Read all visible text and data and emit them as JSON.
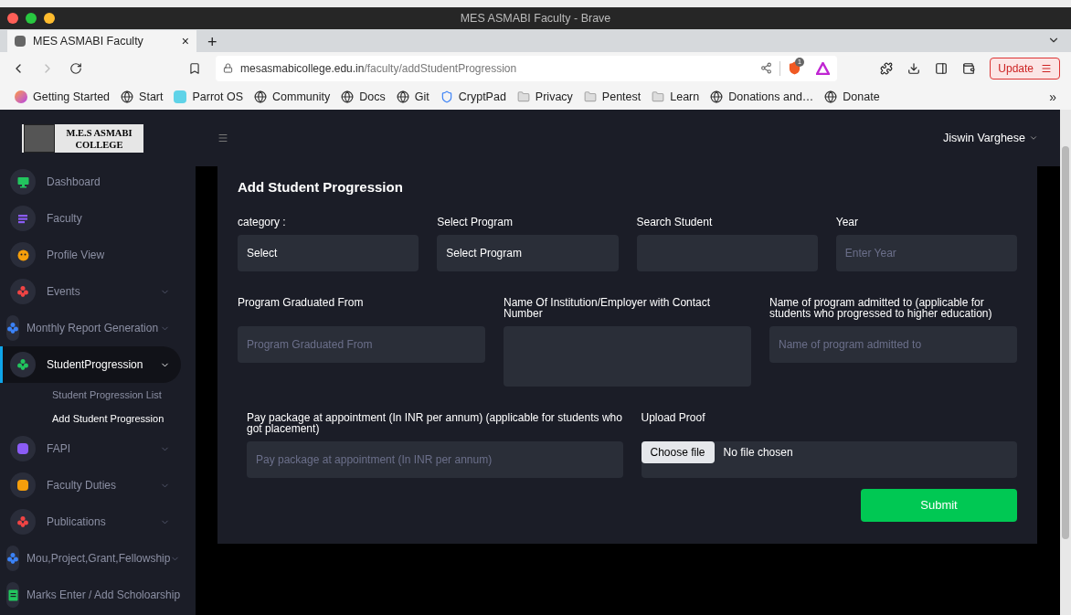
{
  "browser": {
    "window_title": "MES ASMABI Faculty - Brave",
    "tab": {
      "title": "MES ASMABI Faculty",
      "close": "×",
      "new_tab": "+"
    },
    "url": {
      "domain": "mesasmabicollege.edu.in",
      "path": "/faculty/addStudentProgression"
    },
    "shield_count": "1",
    "update_button": "Update",
    "bookmarks": [
      {
        "label": "Getting Started",
        "kind": "firefox"
      },
      {
        "label": "Start",
        "kind": "globe"
      },
      {
        "label": "Parrot OS",
        "kind": "parrot"
      },
      {
        "label": "Community",
        "kind": "globe"
      },
      {
        "label": "Docs",
        "kind": "globe"
      },
      {
        "label": "Git",
        "kind": "globe"
      },
      {
        "label": "CryptPad",
        "kind": "shield"
      },
      {
        "label": "Privacy",
        "kind": "folder"
      },
      {
        "label": "Pentest",
        "kind": "folder"
      },
      {
        "label": "Learn",
        "kind": "folder"
      },
      {
        "label": "Donations and…",
        "kind": "globe"
      },
      {
        "label": "Donate",
        "kind": "globe"
      }
    ],
    "more": "»"
  },
  "sidebar": {
    "logo": [
      "M.E.S ASMABI",
      "COLLEGE"
    ],
    "items": [
      {
        "label": "Dashboard",
        "color": "#22c55e",
        "compact": false,
        "expandable": false,
        "selected": false
      },
      {
        "label": "Faculty",
        "color": "#8b5cf6",
        "compact": false,
        "expandable": false,
        "selected": false
      },
      {
        "label": "Profile View",
        "color": "#f59e0b",
        "compact": false,
        "expandable": false,
        "selected": false
      },
      {
        "label": "Events",
        "color": "#ef4444",
        "compact": false,
        "expandable": true,
        "selected": false
      },
      {
        "label": "Monthly Report Generation",
        "color": "#3b82f6",
        "compact": true,
        "expandable": true,
        "selected": false
      },
      {
        "label": "StudentProgression",
        "color": "#22c55e",
        "compact": false,
        "expandable": true,
        "selected": true,
        "children": [
          {
            "label": "Student Progression List",
            "selected": false
          },
          {
            "label": "Add Student Progression",
            "selected": true
          }
        ]
      },
      {
        "label": "FAPI",
        "color": "#8b5cf6",
        "compact": false,
        "expandable": true,
        "selected": false
      },
      {
        "label": "Faculty Duties",
        "color": "#f59e0b",
        "compact": false,
        "expandable": true,
        "selected": false
      },
      {
        "label": "Publications",
        "color": "#ef4444",
        "compact": false,
        "expandable": true,
        "selected": false
      },
      {
        "label": "Mou,Project,Grant,Fellowship",
        "color": "#3b82f6",
        "compact": true,
        "expandable": true,
        "selected": false
      },
      {
        "label": "Marks Enter / Add Scholoarship",
        "color": "#22c55e",
        "compact": true,
        "expandable": false,
        "selected": false
      }
    ]
  },
  "header": {
    "user_name": "Jiswin Varghese"
  },
  "form": {
    "title": "Add Student Progression",
    "sections": [
      {
        "fields": [
          {
            "label": "category :",
            "kind": "select",
            "value": "Select"
          },
          {
            "label": "Select Program",
            "kind": "select",
            "value": "Select Program"
          },
          {
            "label": "Search Student",
            "kind": "input"
          },
          {
            "label": "Year",
            "kind": "input",
            "placeholder": "Enter Year"
          }
        ]
      },
      {
        "fields": [
          {
            "label": "Program Graduated From",
            "kind": "input",
            "placeholder": "Program Graduated From"
          },
          {
            "label": "Name Of Institution/Employer with Contact Number",
            "kind": "textarea"
          },
          {
            "label": "Name of program admitted to (applicable for students who progressed to higher education)",
            "kind": "input",
            "placeholder": "Name of program admitted to"
          }
        ]
      },
      {
        "fields": [
          {
            "label": "Pay package at appointment (In INR per annum) (applicable for students who got placement)",
            "kind": "input",
            "placeholder": "Pay package at appointment (In INR per annum)"
          },
          {
            "label": "Upload Proof",
            "kind": "file",
            "button": "Choose file",
            "status": "No file chosen"
          }
        ]
      }
    ],
    "submit": "Submit"
  }
}
